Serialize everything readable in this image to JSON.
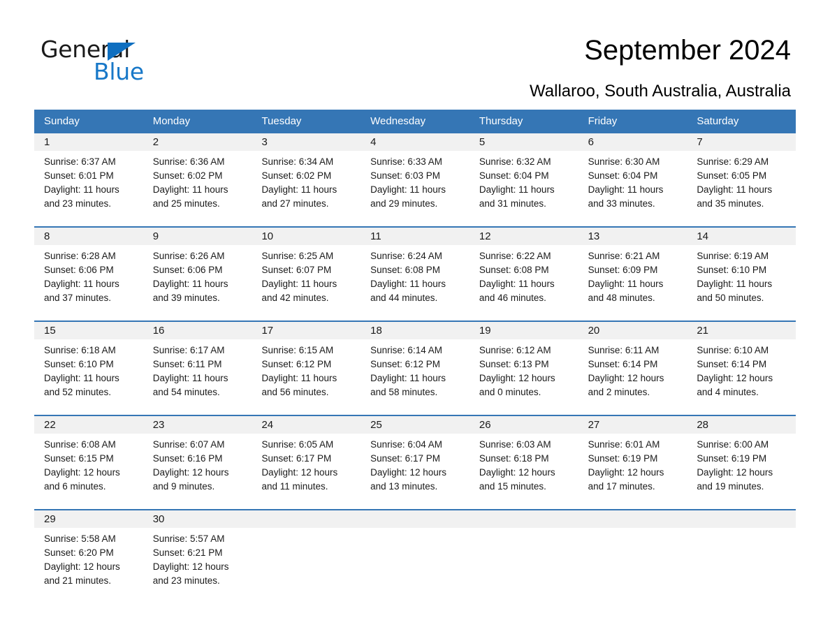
{
  "brand": {
    "name_part1": "General",
    "name_part2": "Blue",
    "triangle_color": "#0f6fc0",
    "blue_color": "#1878c8"
  },
  "header": {
    "month_title": "September 2024",
    "location": "Wallaroo, South Australia, Australia"
  },
  "theme": {
    "header_blue": "#3576b5",
    "row_border_blue": "#3576b5",
    "day_band_gray": "#f1f1f1",
    "text_color": "#1a1a1a"
  },
  "calendar": {
    "weekdays": [
      "Sunday",
      "Monday",
      "Tuesday",
      "Wednesday",
      "Thursday",
      "Friday",
      "Saturday"
    ],
    "weeks": [
      [
        {
          "day": "1",
          "sunrise": "Sunrise: 6:37 AM",
          "sunset": "Sunset: 6:01 PM",
          "daylight1": "Daylight: 11 hours",
          "daylight2": "and 23 minutes."
        },
        {
          "day": "2",
          "sunrise": "Sunrise: 6:36 AM",
          "sunset": "Sunset: 6:02 PM",
          "daylight1": "Daylight: 11 hours",
          "daylight2": "and 25 minutes."
        },
        {
          "day": "3",
          "sunrise": "Sunrise: 6:34 AM",
          "sunset": "Sunset: 6:02 PM",
          "daylight1": "Daylight: 11 hours",
          "daylight2": "and 27 minutes."
        },
        {
          "day": "4",
          "sunrise": "Sunrise: 6:33 AM",
          "sunset": "Sunset: 6:03 PM",
          "daylight1": "Daylight: 11 hours",
          "daylight2": "and 29 minutes."
        },
        {
          "day": "5",
          "sunrise": "Sunrise: 6:32 AM",
          "sunset": "Sunset: 6:04 PM",
          "daylight1": "Daylight: 11 hours",
          "daylight2": "and 31 minutes."
        },
        {
          "day": "6",
          "sunrise": "Sunrise: 6:30 AM",
          "sunset": "Sunset: 6:04 PM",
          "daylight1": "Daylight: 11 hours",
          "daylight2": "and 33 minutes."
        },
        {
          "day": "7",
          "sunrise": "Sunrise: 6:29 AM",
          "sunset": "Sunset: 6:05 PM",
          "daylight1": "Daylight: 11 hours",
          "daylight2": "and 35 minutes."
        }
      ],
      [
        {
          "day": "8",
          "sunrise": "Sunrise: 6:28 AM",
          "sunset": "Sunset: 6:06 PM",
          "daylight1": "Daylight: 11 hours",
          "daylight2": "and 37 minutes."
        },
        {
          "day": "9",
          "sunrise": "Sunrise: 6:26 AM",
          "sunset": "Sunset: 6:06 PM",
          "daylight1": "Daylight: 11 hours",
          "daylight2": "and 39 minutes."
        },
        {
          "day": "10",
          "sunrise": "Sunrise: 6:25 AM",
          "sunset": "Sunset: 6:07 PM",
          "daylight1": "Daylight: 11 hours",
          "daylight2": "and 42 minutes."
        },
        {
          "day": "11",
          "sunrise": "Sunrise: 6:24 AM",
          "sunset": "Sunset: 6:08 PM",
          "daylight1": "Daylight: 11 hours",
          "daylight2": "and 44 minutes."
        },
        {
          "day": "12",
          "sunrise": "Sunrise: 6:22 AM",
          "sunset": "Sunset: 6:08 PM",
          "daylight1": "Daylight: 11 hours",
          "daylight2": "and 46 minutes."
        },
        {
          "day": "13",
          "sunrise": "Sunrise: 6:21 AM",
          "sunset": "Sunset: 6:09 PM",
          "daylight1": "Daylight: 11 hours",
          "daylight2": "and 48 minutes."
        },
        {
          "day": "14",
          "sunrise": "Sunrise: 6:19 AM",
          "sunset": "Sunset: 6:10 PM",
          "daylight1": "Daylight: 11 hours",
          "daylight2": "and 50 minutes."
        }
      ],
      [
        {
          "day": "15",
          "sunrise": "Sunrise: 6:18 AM",
          "sunset": "Sunset: 6:10 PM",
          "daylight1": "Daylight: 11 hours",
          "daylight2": "and 52 minutes."
        },
        {
          "day": "16",
          "sunrise": "Sunrise: 6:17 AM",
          "sunset": "Sunset: 6:11 PM",
          "daylight1": "Daylight: 11 hours",
          "daylight2": "and 54 minutes."
        },
        {
          "day": "17",
          "sunrise": "Sunrise: 6:15 AM",
          "sunset": "Sunset: 6:12 PM",
          "daylight1": "Daylight: 11 hours",
          "daylight2": "and 56 minutes."
        },
        {
          "day": "18",
          "sunrise": "Sunrise: 6:14 AM",
          "sunset": "Sunset: 6:12 PM",
          "daylight1": "Daylight: 11 hours",
          "daylight2": "and 58 minutes."
        },
        {
          "day": "19",
          "sunrise": "Sunrise: 6:12 AM",
          "sunset": "Sunset: 6:13 PM",
          "daylight1": "Daylight: 12 hours",
          "daylight2": "and 0 minutes."
        },
        {
          "day": "20",
          "sunrise": "Sunrise: 6:11 AM",
          "sunset": "Sunset: 6:14 PM",
          "daylight1": "Daylight: 12 hours",
          "daylight2": "and 2 minutes."
        },
        {
          "day": "21",
          "sunrise": "Sunrise: 6:10 AM",
          "sunset": "Sunset: 6:14 PM",
          "daylight1": "Daylight: 12 hours",
          "daylight2": "and 4 minutes."
        }
      ],
      [
        {
          "day": "22",
          "sunrise": "Sunrise: 6:08 AM",
          "sunset": "Sunset: 6:15 PM",
          "daylight1": "Daylight: 12 hours",
          "daylight2": "and 6 minutes."
        },
        {
          "day": "23",
          "sunrise": "Sunrise: 6:07 AM",
          "sunset": "Sunset: 6:16 PM",
          "daylight1": "Daylight: 12 hours",
          "daylight2": "and 9 minutes."
        },
        {
          "day": "24",
          "sunrise": "Sunrise: 6:05 AM",
          "sunset": "Sunset: 6:17 PM",
          "daylight1": "Daylight: 12 hours",
          "daylight2": "and 11 minutes."
        },
        {
          "day": "25",
          "sunrise": "Sunrise: 6:04 AM",
          "sunset": "Sunset: 6:17 PM",
          "daylight1": "Daylight: 12 hours",
          "daylight2": "and 13 minutes."
        },
        {
          "day": "26",
          "sunrise": "Sunrise: 6:03 AM",
          "sunset": "Sunset: 6:18 PM",
          "daylight1": "Daylight: 12 hours",
          "daylight2": "and 15 minutes."
        },
        {
          "day": "27",
          "sunrise": "Sunrise: 6:01 AM",
          "sunset": "Sunset: 6:19 PM",
          "daylight1": "Daylight: 12 hours",
          "daylight2": "and 17 minutes."
        },
        {
          "day": "28",
          "sunrise": "Sunrise: 6:00 AM",
          "sunset": "Sunset: 6:19 PM",
          "daylight1": "Daylight: 12 hours",
          "daylight2": "and 19 minutes."
        }
      ],
      [
        {
          "day": "29",
          "sunrise": "Sunrise: 5:58 AM",
          "sunset": "Sunset: 6:20 PM",
          "daylight1": "Daylight: 12 hours",
          "daylight2": "and 21 minutes."
        },
        {
          "day": "30",
          "sunrise": "Sunrise: 5:57 AM",
          "sunset": "Sunset: 6:21 PM",
          "daylight1": "Daylight: 12 hours",
          "daylight2": "and 23 minutes."
        },
        {
          "day": "",
          "sunrise": "",
          "sunset": "",
          "daylight1": "",
          "daylight2": ""
        },
        {
          "day": "",
          "sunrise": "",
          "sunset": "",
          "daylight1": "",
          "daylight2": ""
        },
        {
          "day": "",
          "sunrise": "",
          "sunset": "",
          "daylight1": "",
          "daylight2": ""
        },
        {
          "day": "",
          "sunrise": "",
          "sunset": "",
          "daylight1": "",
          "daylight2": ""
        },
        {
          "day": "",
          "sunrise": "",
          "sunset": "",
          "daylight1": "",
          "daylight2": ""
        }
      ]
    ]
  }
}
